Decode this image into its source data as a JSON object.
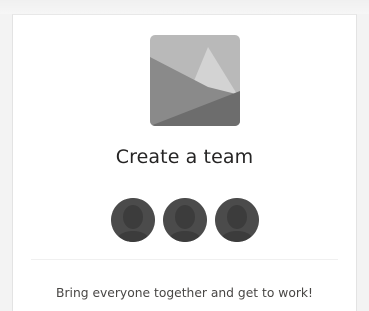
{
  "card": {
    "title": "Create a team",
    "subtitle": "Bring everyone together and get to work!",
    "icons": {
      "thumbnail": "team-image-icon",
      "avatars": [
        "person-icon",
        "person-icon",
        "person-icon"
      ]
    },
    "colors": {
      "avatar": "#4b4b4b",
      "title": "#252424",
      "subtitle": "#484644"
    }
  }
}
